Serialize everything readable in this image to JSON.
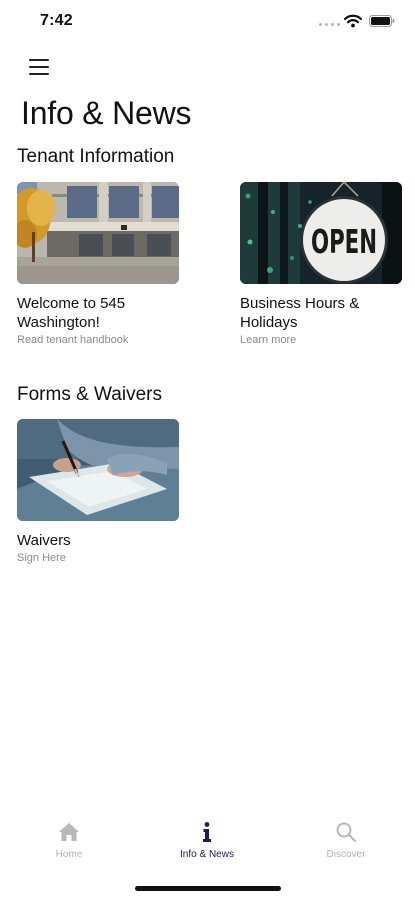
{
  "status_bar": {
    "time": "7:42"
  },
  "header": {
    "menu_icon": "hamburger-menu-icon",
    "title": "Info & News"
  },
  "sections": [
    {
      "title": "Tenant Information",
      "cards": [
        {
          "title": "Welcome to 545 Washington!",
          "subtitle": "Read tenant handbook",
          "image": "office-building-photo"
        },
        {
          "title": "Business Hours & Holidays",
          "subtitle": "Learn more",
          "image": "open-sign-photo",
          "sign_text": "OPEN"
        }
      ]
    },
    {
      "title": "Forms & Waivers",
      "cards": [
        {
          "title": "Waivers",
          "subtitle": "Sign Here",
          "image": "signing-document-photo"
        }
      ]
    }
  ],
  "bottom_nav": {
    "items": [
      {
        "label": "Home",
        "icon": "home-icon",
        "active": false
      },
      {
        "label": "Info & News",
        "icon": "info-icon",
        "active": true
      },
      {
        "label": "Discover",
        "icon": "search-icon",
        "active": false
      }
    ]
  },
  "colors": {
    "active_nav": "#1b1f58",
    "inactive_nav": "#b3b3b3",
    "subtitle": "#8a8a8a"
  }
}
